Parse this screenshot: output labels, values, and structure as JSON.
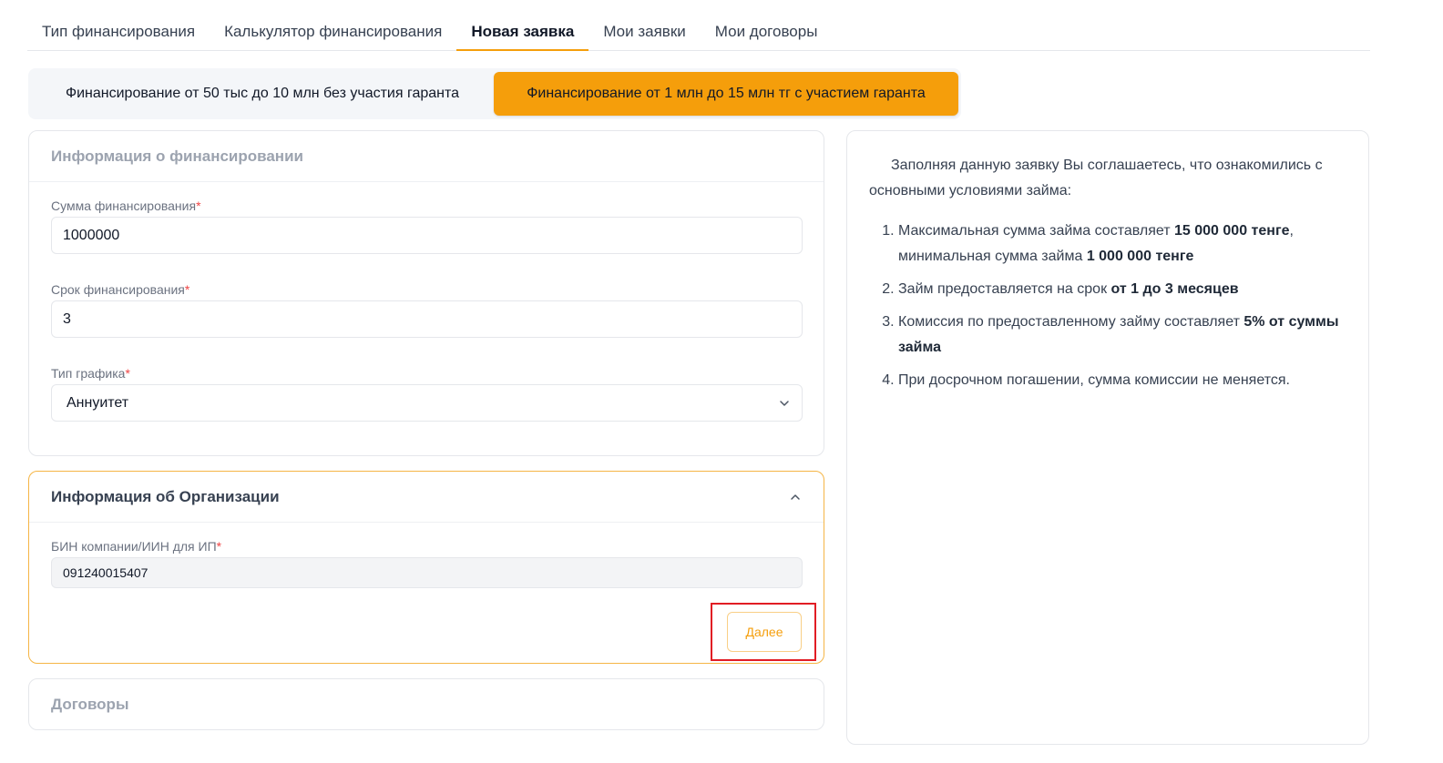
{
  "tabs": [
    {
      "label": "Тип финансирования"
    },
    {
      "label": "Калькулятор финансирования"
    },
    {
      "label": "Новая заявка"
    },
    {
      "label": "Мои заявки"
    },
    {
      "label": "Мои договоры"
    }
  ],
  "active_tab": "Новая заявка",
  "segment": {
    "left_label": "Финансирование от 50 тыс до 10 млн без участия гаранта",
    "right_label": "Финансирование от 1 млн до 15 млн тг с участием гаранта"
  },
  "financing_panel": {
    "title": "Информация о финансировании",
    "amount": {
      "label": "Сумма финансирования",
      "value": "1000000"
    },
    "term": {
      "label": "Срок финансирования",
      "value": "3"
    },
    "schedule": {
      "label": "Тип графика",
      "value": "Аннуитет"
    }
  },
  "org_panel": {
    "title": "Информация об Организации",
    "bin": {
      "label": "БИН компании/ИИН для ИП",
      "value": "091240015407"
    },
    "next_label": "Далее"
  },
  "contracts_panel": {
    "title": "Договоры"
  },
  "required_mark": "*",
  "info": {
    "intro": "Заполняя данную заявку Вы соглашаетесь, что ознакомились с основными условиями займа:",
    "items": [
      {
        "pre": "Максимальная сумма займа составляет ",
        "b1": "15 000 000 тенге",
        "mid": ", минимальная сумма займа ",
        "b2": "1 000 000 тенге"
      },
      {
        "pre": "Займ предоставляется на срок ",
        "b1": "от 1 до 3 месяцев"
      },
      {
        "pre": "Комиссия по предоставленному займу составляет ",
        "b1": "5% от суммы займа"
      },
      {
        "pre": "При досрочном погашении, сумма комиссии не меняется."
      }
    ]
  },
  "colors": {
    "accent": "#f59e0b",
    "highlight_box": "#e11d24"
  },
  "icons": {
    "schedule_dropdown": "chevron-down-icon",
    "org_collapse": "chevron-up-icon"
  }
}
